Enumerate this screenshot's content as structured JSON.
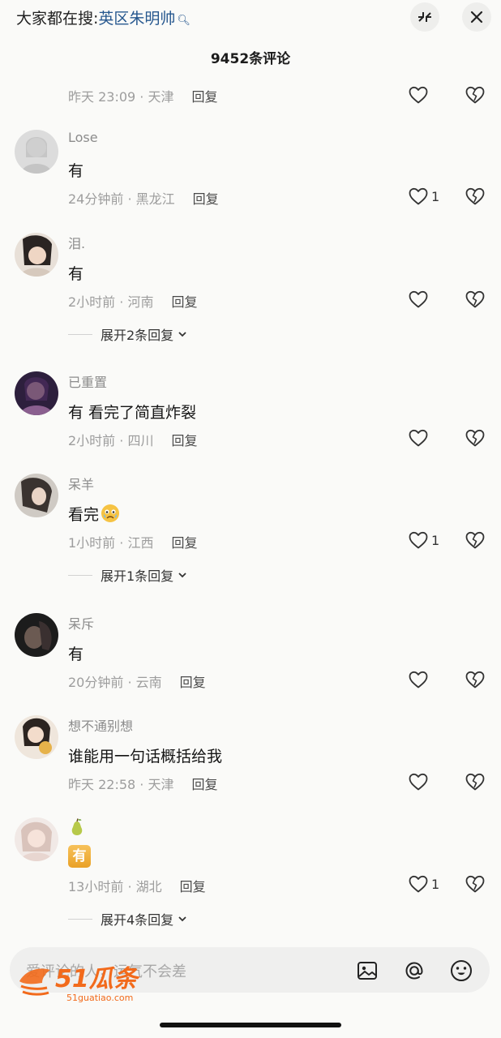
{
  "header": {
    "search_prefix": "大家都在搜:",
    "search_keyword": "英区朱明帅",
    "comment_count_title": "9452条评论"
  },
  "first_meta": {
    "time": "昨天 23:09",
    "location": "天津",
    "reply": "回复"
  },
  "comments": [
    {
      "username": "Lose",
      "text": "有",
      "time": "24分钟前",
      "location": "黑龙江",
      "reply": "回复",
      "likes": "1"
    },
    {
      "username": "泪.",
      "text": "有",
      "time": "2小时前",
      "location": "河南",
      "reply": "回复",
      "expand": "展开2条回复"
    },
    {
      "username": "已重置",
      "text": "有 看完了简直炸裂",
      "time": "2小时前",
      "location": "四川",
      "reply": "回复"
    },
    {
      "username": "呆羊",
      "text": "看完",
      "emoji": "crying-face-emoji",
      "time": "1小时前",
      "location": "江西",
      "reply": "回复",
      "likes": "1",
      "expand": "展开1条回复"
    },
    {
      "username": "呆斥",
      "text": "有",
      "time": "20分钟前",
      "location": "云南",
      "reply": "回复"
    },
    {
      "username": "想不通别想",
      "text": "谁能用一句话概括给我",
      "time": "昨天 22:58",
      "location": "天津",
      "reply": "回复"
    },
    {
      "username": "",
      "username_emoji": "pear-emoji",
      "text": "有",
      "time": "13小时前",
      "location": "湖北",
      "reply": "回复",
      "likes": "1",
      "expand": "展开4条回复"
    }
  ],
  "composer": {
    "placeholder": "爱评论的人，运气不会差",
    "image_icon": "image-icon",
    "at_icon": "at-icon",
    "emoji_icon": "emoji-icon"
  },
  "watermark": {
    "logo_text": "51瓜条",
    "url": "51guatiao.com"
  },
  "icons": {
    "like": "heart-outline-icon",
    "dislike": "broken-heart-icon",
    "collapse": "collapse-icon",
    "close": "close-icon"
  },
  "colors": {
    "keyword": "#27588f",
    "watermark": "#f26a1b"
  }
}
